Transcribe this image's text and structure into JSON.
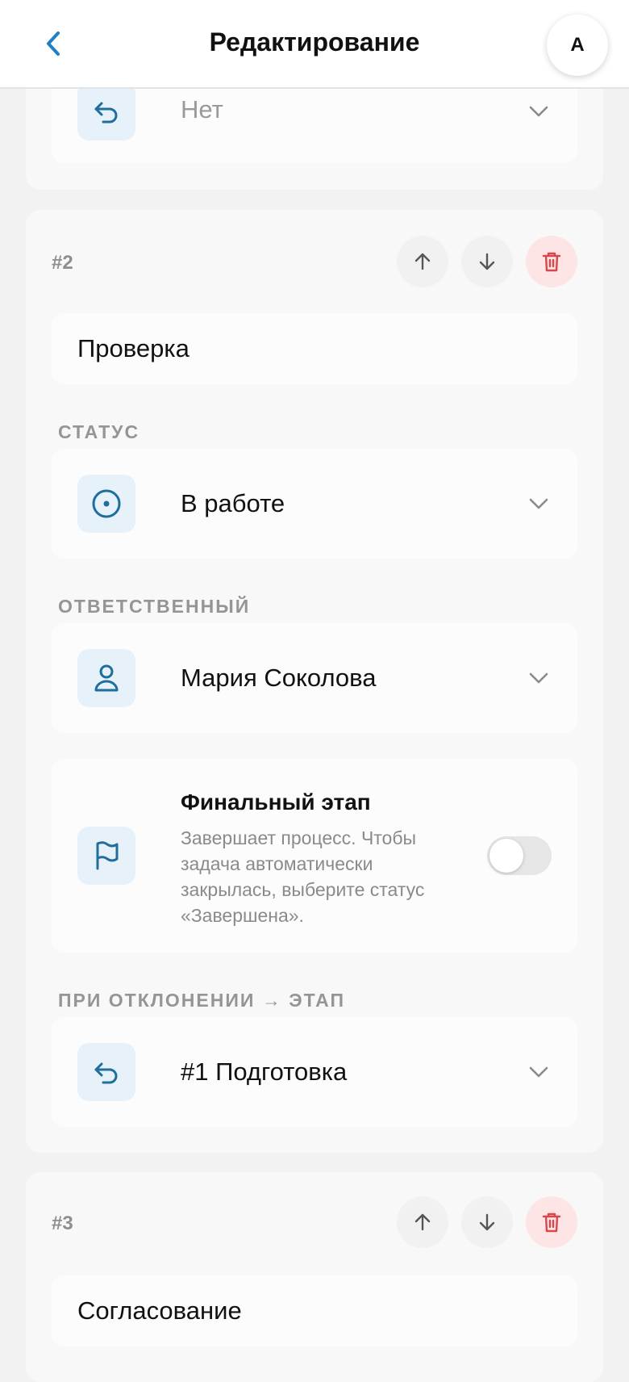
{
  "header": {
    "title": "Редактирование",
    "avatar_letter": "A"
  },
  "step1_partial": {
    "return_value": "Нет"
  },
  "step2": {
    "number": "#2",
    "name": "Проверка",
    "status_label": "СТАТУС",
    "status_value": "В работе",
    "assignee_label": "ОТВЕТСТВЕННЫЙ",
    "assignee_value": "Мария Соколова",
    "final_title": "Финальный этап",
    "final_desc": "Завершает процесс. Чтобы задача автоматически закрылась, выберите статус «Завершена».",
    "final_toggle_on": false,
    "reject_label": "ПРИ ОТКЛОНЕНИИ → ЭТАП",
    "reject_value": "#1 Подготовка"
  },
  "step3": {
    "number": "#3",
    "name": "Согласование"
  },
  "colors": {
    "accent": "#1f7fc4",
    "icon_dark": "#1e6e9e",
    "danger": "#d9474a"
  }
}
